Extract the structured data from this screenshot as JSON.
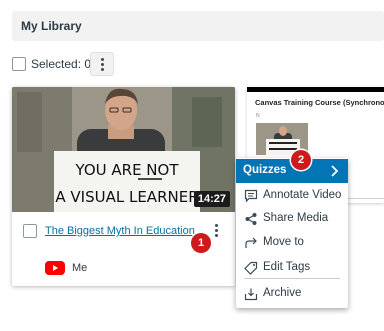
{
  "library": {
    "title": "My Library"
  },
  "selection": {
    "label": "Selected: 0",
    "more_icon": "kebab-icon"
  },
  "video_card": {
    "duration": "14:27",
    "title": "The Biggest Myth In Education",
    "thumbnail_sign": [
      "YOU ARE NOT",
      "A VISUAL LEARNER"
    ],
    "source_icon": "youtube-icon",
    "owner": "Me"
  },
  "second_card": {
    "title": "Canvas Training Course (Synchronous)",
    "small_text": "N"
  },
  "context_menu": {
    "items": [
      {
        "label": "Quizzes",
        "icon": "chevron-right-icon",
        "active": true
      },
      {
        "label": "Annotate Video",
        "icon": "comment-icon"
      },
      {
        "label": "Share Media",
        "icon": "share-icon"
      },
      {
        "label": "Move to",
        "icon": "move-arrow-icon"
      },
      {
        "label": "Edit Tags",
        "icon": "tag-icon"
      },
      {
        "label": "Archive",
        "icon": "archive-icon"
      }
    ]
  },
  "callouts": {
    "step1": "1",
    "step2": "2"
  },
  "colors": {
    "accent": "#0374b5",
    "link": "#0770a3",
    "badge": "#d0191a",
    "youtube": "#ff0000"
  }
}
